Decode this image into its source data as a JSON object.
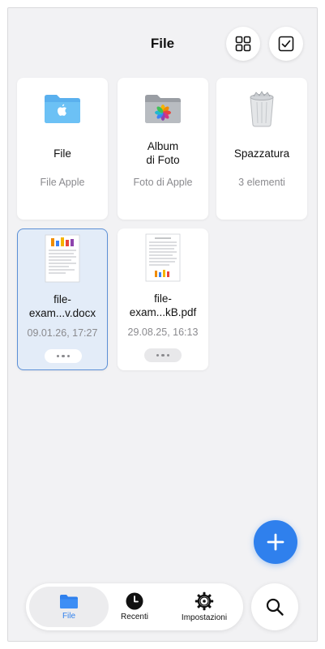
{
  "header": {
    "title": "File"
  },
  "items": [
    {
      "name": "File",
      "subtitle": "File Apple",
      "icon": "blue-folder-icon"
    },
    {
      "name": "Album\ndi Foto",
      "subtitle": "Foto di Apple",
      "icon": "photos-folder-icon"
    },
    {
      "name": "Spazzatura",
      "subtitle": "3 elementi",
      "icon": "trash-icon"
    },
    {
      "name": "file-\nexam...v.docx",
      "subtitle": "09.01.26, 17:27",
      "icon": "docx-thumbnail",
      "selected": true
    },
    {
      "name": "file-\nexam...kB.pdf",
      "subtitle": "29.08.25, 16:13",
      "icon": "pdf-thumbnail"
    }
  ],
  "tabbar": {
    "tabs": [
      {
        "label": "File",
        "icon": "folder-icon",
        "active": true
      },
      {
        "label": "Recenti",
        "icon": "clock-icon"
      },
      {
        "label": "Impostazioni",
        "icon": "gear-icon"
      }
    ]
  },
  "colors": {
    "accent": "#2f80ed",
    "background": "#f2f2f4",
    "selected_card": "#e3ecf8"
  }
}
